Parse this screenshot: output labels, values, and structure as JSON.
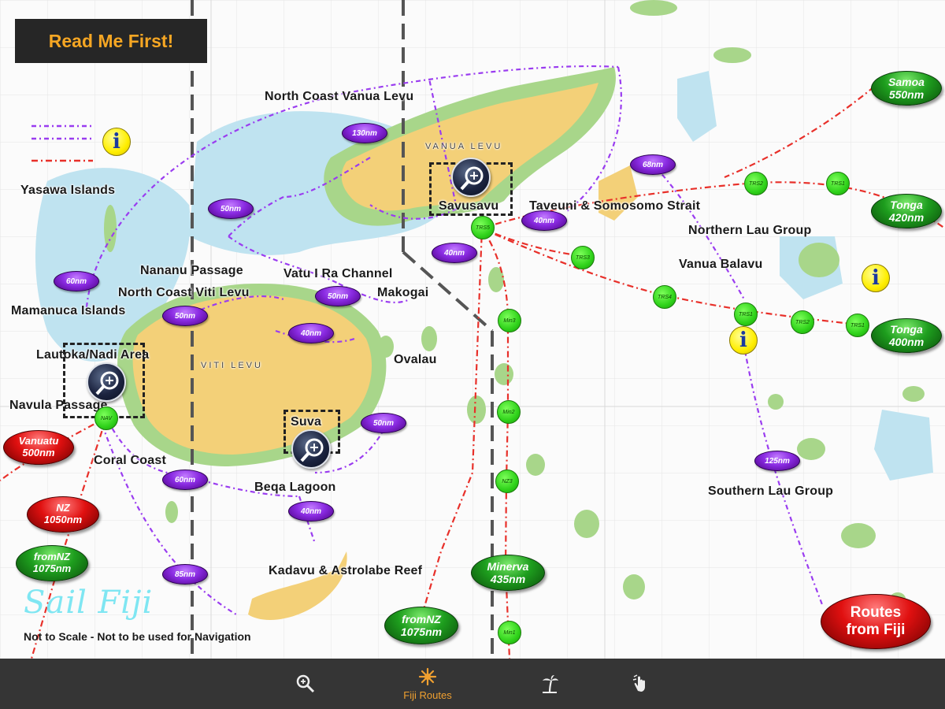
{
  "header": {
    "read_me": "Read Me First!"
  },
  "legend": {
    "info_icon": "info-icon"
  },
  "regions": {
    "north_coast_vanua_levu": "North Coast Vanua Levu",
    "yasawa": "Yasawa Islands",
    "savusavu": "Savusavu",
    "taveuni": "Taveuni & Somosomo Strait",
    "northern_lau": "Northern Lau Group",
    "vanua_balavu": "Vanua Balavu",
    "nananu": "Nananu Passage",
    "vatu_ira": "Vatu I Ra Channel",
    "makogai": "Makogai",
    "north_coast_viti_levu": "North Coast Viti Levu",
    "mamanuca": "Mamanuca Islands",
    "lautoka": "Lautoka/Nadi Area",
    "ovalau": "Ovalau",
    "navula": "Navula Passage",
    "suva": "Suva",
    "coral_coast": "Coral Coast",
    "beqa": "Beqa Lagoon",
    "southern_lau": "Southern Lau Group",
    "kadavu": "Kadavu & Astrolabe Reef",
    "vanua_levu_chart": "VANUA LEVU",
    "viti_levu_chart": "VITI LEVU"
  },
  "distances": {
    "d1": "130nm",
    "d2": "50nm",
    "d3": "40nm",
    "d4": "68nm",
    "d5": "40nm",
    "d6": "60nm",
    "d7": "50nm",
    "d8": "50nm",
    "d9": "40nm",
    "d10": "50nm",
    "d11": "60nm",
    "d12": "40nm",
    "d13": "85nm",
    "d14": "125nm"
  },
  "waypoints": {
    "trs5": "TRS5",
    "trs3": "TRS3",
    "trs4": "TRS4",
    "trs2": "TRS2",
    "trs1": "TRS1",
    "trs2b": "TRS2",
    "trs1b": "TRS1",
    "trs1c": "TRS1",
    "min3": "Min3",
    "min2": "Min2",
    "nz3": "NZ3",
    "min1": "Min1",
    "nav": "NAV"
  },
  "destinations": {
    "samoa": {
      "name": "Samoa",
      "dist": "550nm"
    },
    "tonga1": {
      "name": "Tonga",
      "dist": "420nm"
    },
    "tonga2": {
      "name": "Tonga",
      "dist": "400nm"
    },
    "vanuatu": {
      "name": "Vanuatu",
      "dist": "500nm"
    },
    "nz": {
      "name": "NZ",
      "dist": "1050nm"
    },
    "from_nz_1": {
      "name": "fromNZ",
      "dist": "1075nm"
    },
    "minerva": {
      "name": "Minerva",
      "dist": "435nm"
    },
    "from_nz_2": {
      "name": "fromNZ",
      "dist": "1075nm"
    },
    "routes_from_fiji": {
      "line1": "Routes",
      "line2": "from Fiji"
    }
  },
  "footer": {
    "logo": "Sail Fiji",
    "disclaimer": "Not to Scale - Not to be used for Navigation"
  },
  "tabbar": {
    "tabs": [
      {
        "icon": "zoom-icon",
        "label": ""
      },
      {
        "icon": "sun-compass-icon",
        "label": "Fiji Routes"
      },
      {
        "icon": "palm-tree-icon",
        "label": ""
      },
      {
        "icon": "touch-hand-icon",
        "label": ""
      }
    ]
  },
  "colors": {
    "land": "#f3d078",
    "land_green": "#a8d68a",
    "shallow": "#bfe3f0",
    "route_purple": "#9a3cf0",
    "route_red": "#e8302a",
    "tab_active": "#f0a030"
  }
}
